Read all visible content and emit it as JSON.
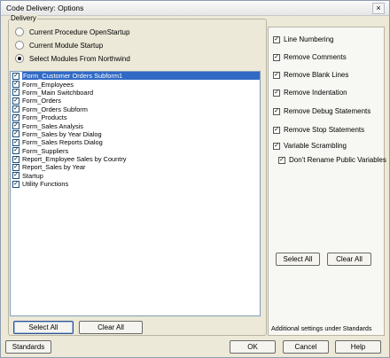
{
  "window": {
    "title": "Code Delivery: Options",
    "close_glyph": "×"
  },
  "delivery": {
    "label": "Delivery",
    "radios": [
      {
        "label": "Current Procedure OpenStartup",
        "selected": false
      },
      {
        "label": "Current Module Startup",
        "selected": false
      },
      {
        "label": "Select Modules From Northwind",
        "selected": true
      }
    ],
    "modules": [
      {
        "label": "Form_Customer Orders Subform1",
        "checked": true,
        "selected": true
      },
      {
        "label": "Form_Employees",
        "checked": true
      },
      {
        "label": "Form_Main Switchboard",
        "checked": true
      },
      {
        "label": "Form_Orders",
        "checked": true
      },
      {
        "label": "Form_Orders Subform",
        "checked": true
      },
      {
        "label": "Form_Products",
        "checked": true
      },
      {
        "label": "Form_Sales Analysis",
        "checked": true
      },
      {
        "label": "Form_Sales by Year Dialog",
        "checked": true
      },
      {
        "label": "Form_Sales Reports Dialog",
        "checked": true
      },
      {
        "label": "Form_Suppliers",
        "checked": true
      },
      {
        "label": "Report_Employee Sales by Country",
        "checked": true
      },
      {
        "label": "Report_Sales by Year",
        "checked": true
      },
      {
        "label": "Startup",
        "checked": true
      },
      {
        "label": "Utility Functions",
        "checked": true
      }
    ],
    "select_all_label": "Select All",
    "clear_all_label": "Clear All"
  },
  "options": {
    "items": [
      {
        "label": "Line Numbering",
        "checked": true
      },
      {
        "label": "Remove Comments",
        "checked": true
      },
      {
        "label": "Remove Blank Lines",
        "checked": true
      },
      {
        "label": "Remove Indentation",
        "checked": true
      },
      {
        "label": "Remove Debug Statements",
        "checked": true
      },
      {
        "label": "Remove Stop Statements",
        "checked": true
      },
      {
        "label": "Variable Scrambling",
        "checked": true
      },
      {
        "label": "Don't Rename Public Variables",
        "checked": true
      }
    ],
    "select_all_label": "Select All",
    "clear_all_label": "Clear All",
    "note": "Additional settings under Standards"
  },
  "footer": {
    "standards_label": "Standards",
    "ok_label": "OK",
    "cancel_label": "Cancel",
    "help_label": "Help"
  },
  "check_glyph": "✓"
}
